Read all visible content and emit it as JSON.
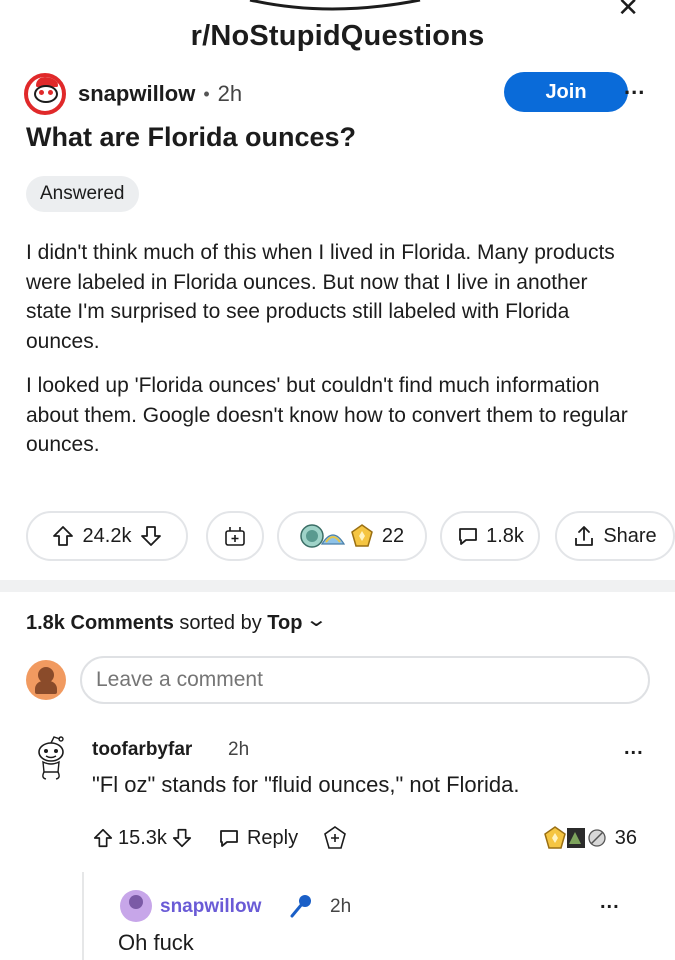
{
  "subreddit": "r/NoStupidQuestions",
  "post": {
    "author": "snapwillow",
    "separator": "•",
    "age": "2h",
    "join_label": "Join",
    "more_label": "...",
    "title": "What are Florida ounces?",
    "flair": "Answered",
    "paragraphs": [
      "I didn't think much of this when I lived in Florida. Many products were labeled in Florida ounces. But now that I live in another state I'm surprised to see products still labeled with Florida ounces.",
      "I looked up 'Florida ounces' but couldn't find much information about them. Google doesn't know how to convert them to regular ounces."
    ],
    "votes": "24.2k",
    "awards_count": "22",
    "comments_count": "1.8k",
    "share_label": "Share"
  },
  "comments_header": {
    "count": "1.8k",
    "label": "Comments",
    "sorted_by": "sorted by",
    "sort": "Top",
    "chevron": "⌄"
  },
  "comment_box": {
    "placeholder": "Leave a comment"
  },
  "comments": [
    {
      "user": "toofarbyfar",
      "age": "2h",
      "text": "\"Fl oz\" stands for \"fluid ounces,\" not Florida.",
      "votes": "15.3k",
      "reply_label": "Reply",
      "awards_count": "36",
      "more_label": "...",
      "replies": [
        {
          "user": "snapwillow",
          "age": "2h",
          "text": "Oh fuck",
          "more_label": "..."
        }
      ]
    }
  ],
  "colors": {
    "join_button": "#0a6bd9",
    "op_name": "#6a5bd6",
    "divider": "#f0f1f2"
  }
}
